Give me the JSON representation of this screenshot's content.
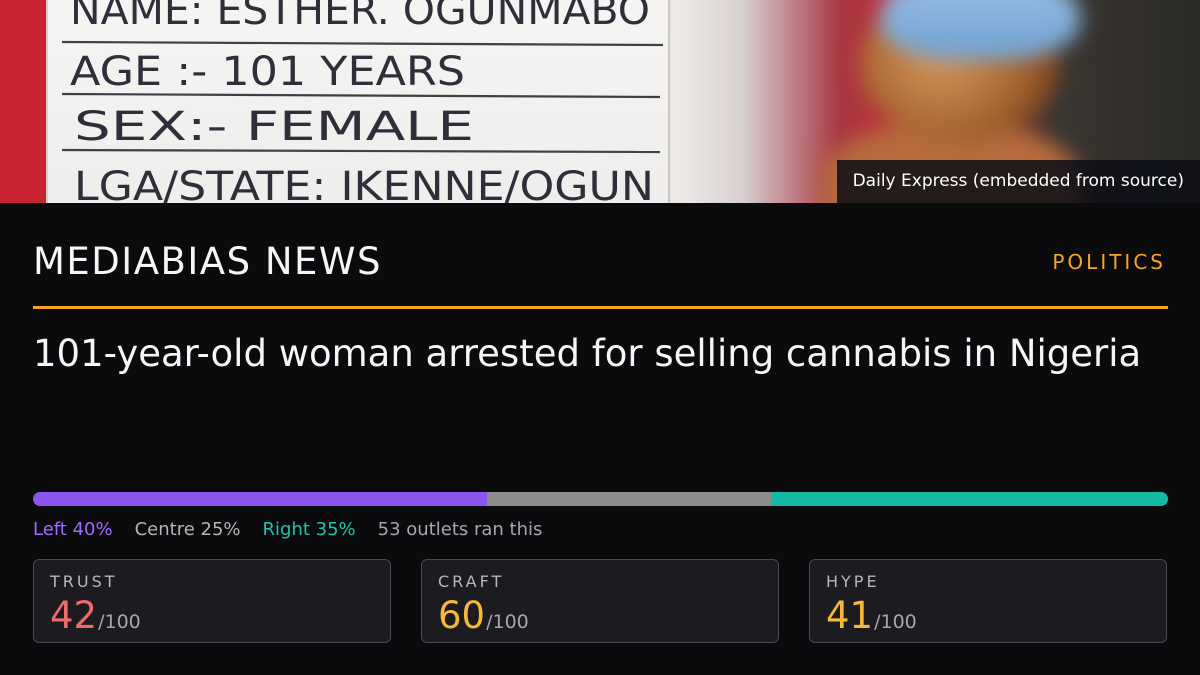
{
  "hero": {
    "board_lines": [
      "NAME: ESTHER. OGUNMABO",
      "AGE :- 101 YEARS",
      "SEX:- FEMALE",
      "LGA/STATE: IKENNE/OGUN"
    ],
    "caption": "Daily Express (embedded from source)"
  },
  "header": {
    "brand": "MEDIABIAS NEWS",
    "category": "POLITICS",
    "accent_color": "#f5a623"
  },
  "article": {
    "headline": "101-year-old woman arrested for selling cannabis in Nigeria"
  },
  "coverage": {
    "segments": [
      {
        "name": "Left",
        "percent": 40,
        "color": "#8b55f0"
      },
      {
        "name": "Centre",
        "percent": 25,
        "color": "#8e8c8a"
      },
      {
        "name": "Right",
        "percent": 35,
        "color": "#15b8a2"
      }
    ],
    "left_label": "Left 40%",
    "centre_label": "Centre 25%",
    "right_label": "Right 35%",
    "outlets_label": "53 outlets ran this"
  },
  "scores": [
    {
      "label": "TRUST",
      "value": "42",
      "max": "/100",
      "color": "#ef6b6b"
    },
    {
      "label": "CRAFT",
      "value": "60",
      "max": "/100",
      "color": "#f5b934"
    },
    {
      "label": "HYPE",
      "value": "41",
      "max": "/100",
      "color": "#f5b934"
    }
  ]
}
